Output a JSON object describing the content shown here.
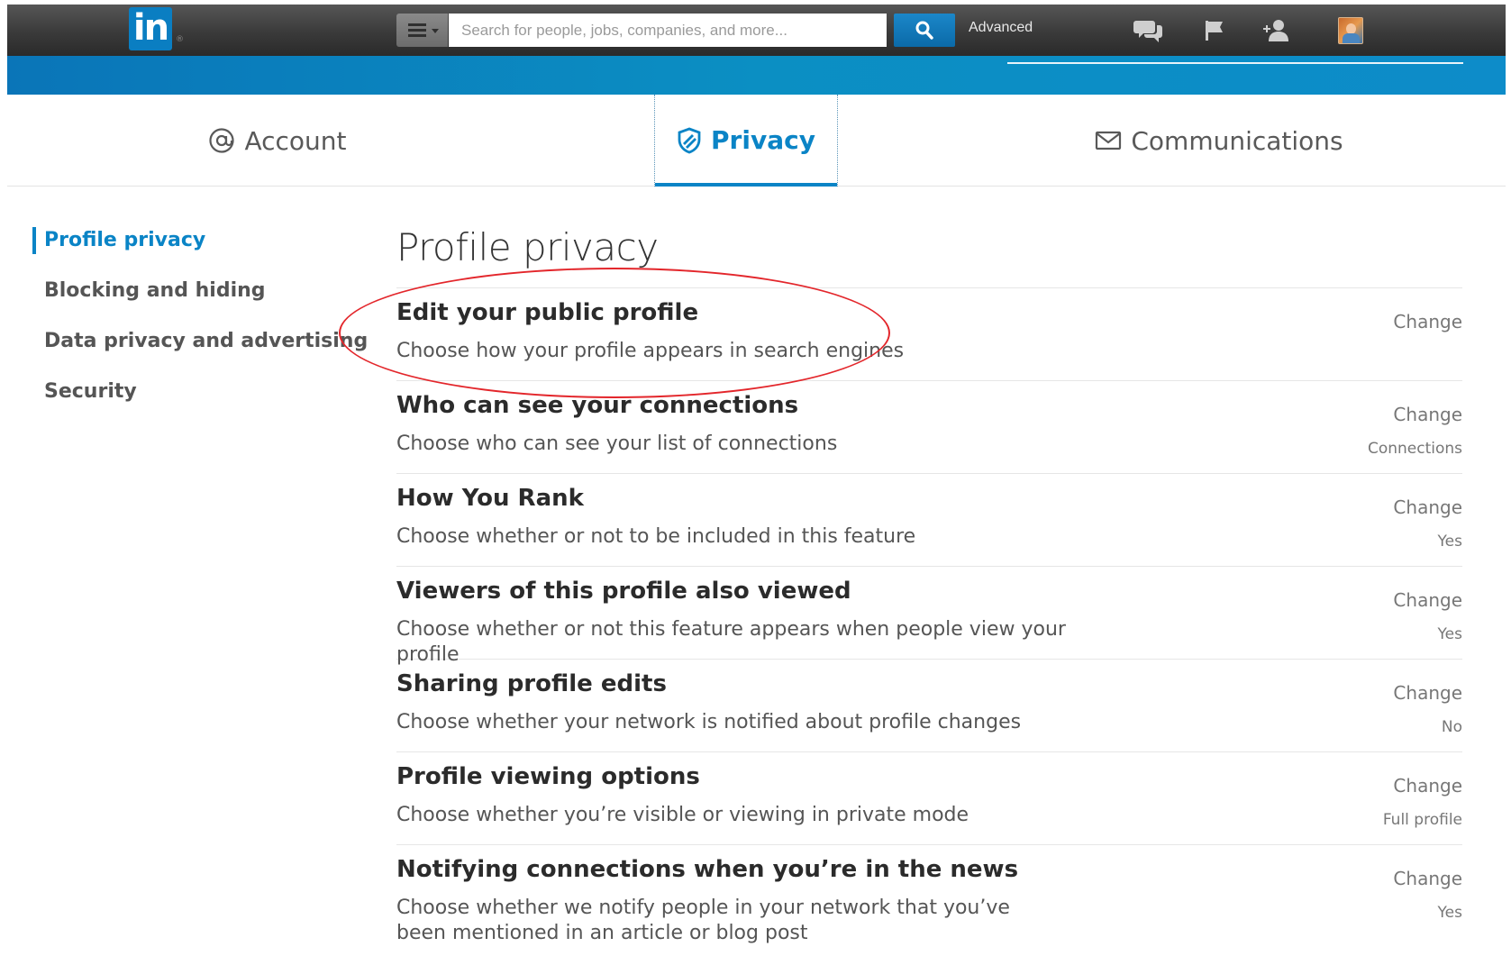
{
  "topbar": {
    "logo_text": "in",
    "logo_mark": "®",
    "search_placeholder": "Search for people, jobs, companies, and more...",
    "advanced_label": "Advanced",
    "icons": [
      "menu-icon",
      "search-icon",
      "messages-icon",
      "notifications-flag-icon",
      "add-connections-icon",
      "profile-avatar"
    ],
    "brand_color": "#0a7ec2"
  },
  "tabs": [
    {
      "label": "Account",
      "icon": "at-sign-icon",
      "active": false
    },
    {
      "label": "Privacy",
      "icon": "shield-icon",
      "active": true
    },
    {
      "label": "Communications",
      "icon": "envelope-icon",
      "active": false
    }
  ],
  "sidebar": {
    "items": [
      {
        "label": "Profile privacy",
        "active": true
      },
      {
        "label": "Blocking and hiding",
        "active": false
      },
      {
        "label": "Data privacy and advertising",
        "active": false
      },
      {
        "label": "Security",
        "active": false
      }
    ]
  },
  "main": {
    "title": "Profile privacy",
    "settings": [
      {
        "title": "Edit your public profile",
        "description": "Choose how your profile appears in search engines",
        "action": "Change",
        "value": ""
      },
      {
        "title": "Who can see your connections",
        "description": "Choose who can see your list of connections",
        "action": "Change",
        "value": "Connections"
      },
      {
        "title": "How You Rank",
        "description": "Choose whether or not to be included in this feature",
        "action": "Change",
        "value": "Yes"
      },
      {
        "title": "Viewers of this profile also viewed",
        "description": "Choose whether or not this feature appears when people view your profile",
        "action": "Change",
        "value": "Yes"
      },
      {
        "title": "Sharing profile edits",
        "description": "Choose whether your network is notified about profile changes",
        "action": "Change",
        "value": "No"
      },
      {
        "title": "Profile viewing options",
        "description": "Choose whether you’re visible or viewing in private mode",
        "action": "Change",
        "value": "Full profile"
      },
      {
        "title": "Notifying connections when you’re in the news",
        "description": "Choose whether we notify people in your network that you’ve been mentioned in an article or blog post",
        "action": "Change",
        "value": "Yes"
      }
    ]
  },
  "colors": {
    "accent": "#0a84c6",
    "annotation": "#e3262b",
    "topbar": "#3a3a3a"
  }
}
